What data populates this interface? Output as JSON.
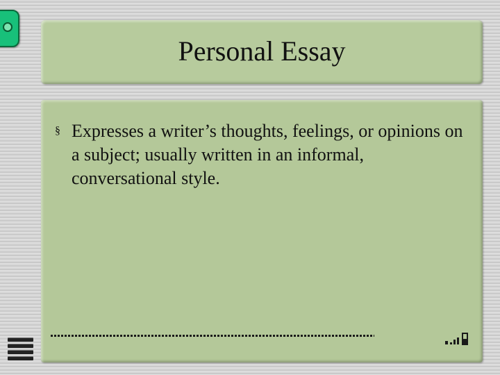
{
  "slide": {
    "title": "Personal Essay",
    "bullets": [
      {
        "marker": "§",
        "text": "Expresses a writer’s thoughts, feelings, or opinions on a subject; usually written in an informal, conversational style."
      }
    ]
  },
  "icons": {
    "corner": "tab-ring-icon",
    "signal": "signal-bars-icon",
    "menu": "menu-lines-icon"
  },
  "colors": {
    "panel": "#b7cb9d",
    "tab": "#18c07a"
  }
}
